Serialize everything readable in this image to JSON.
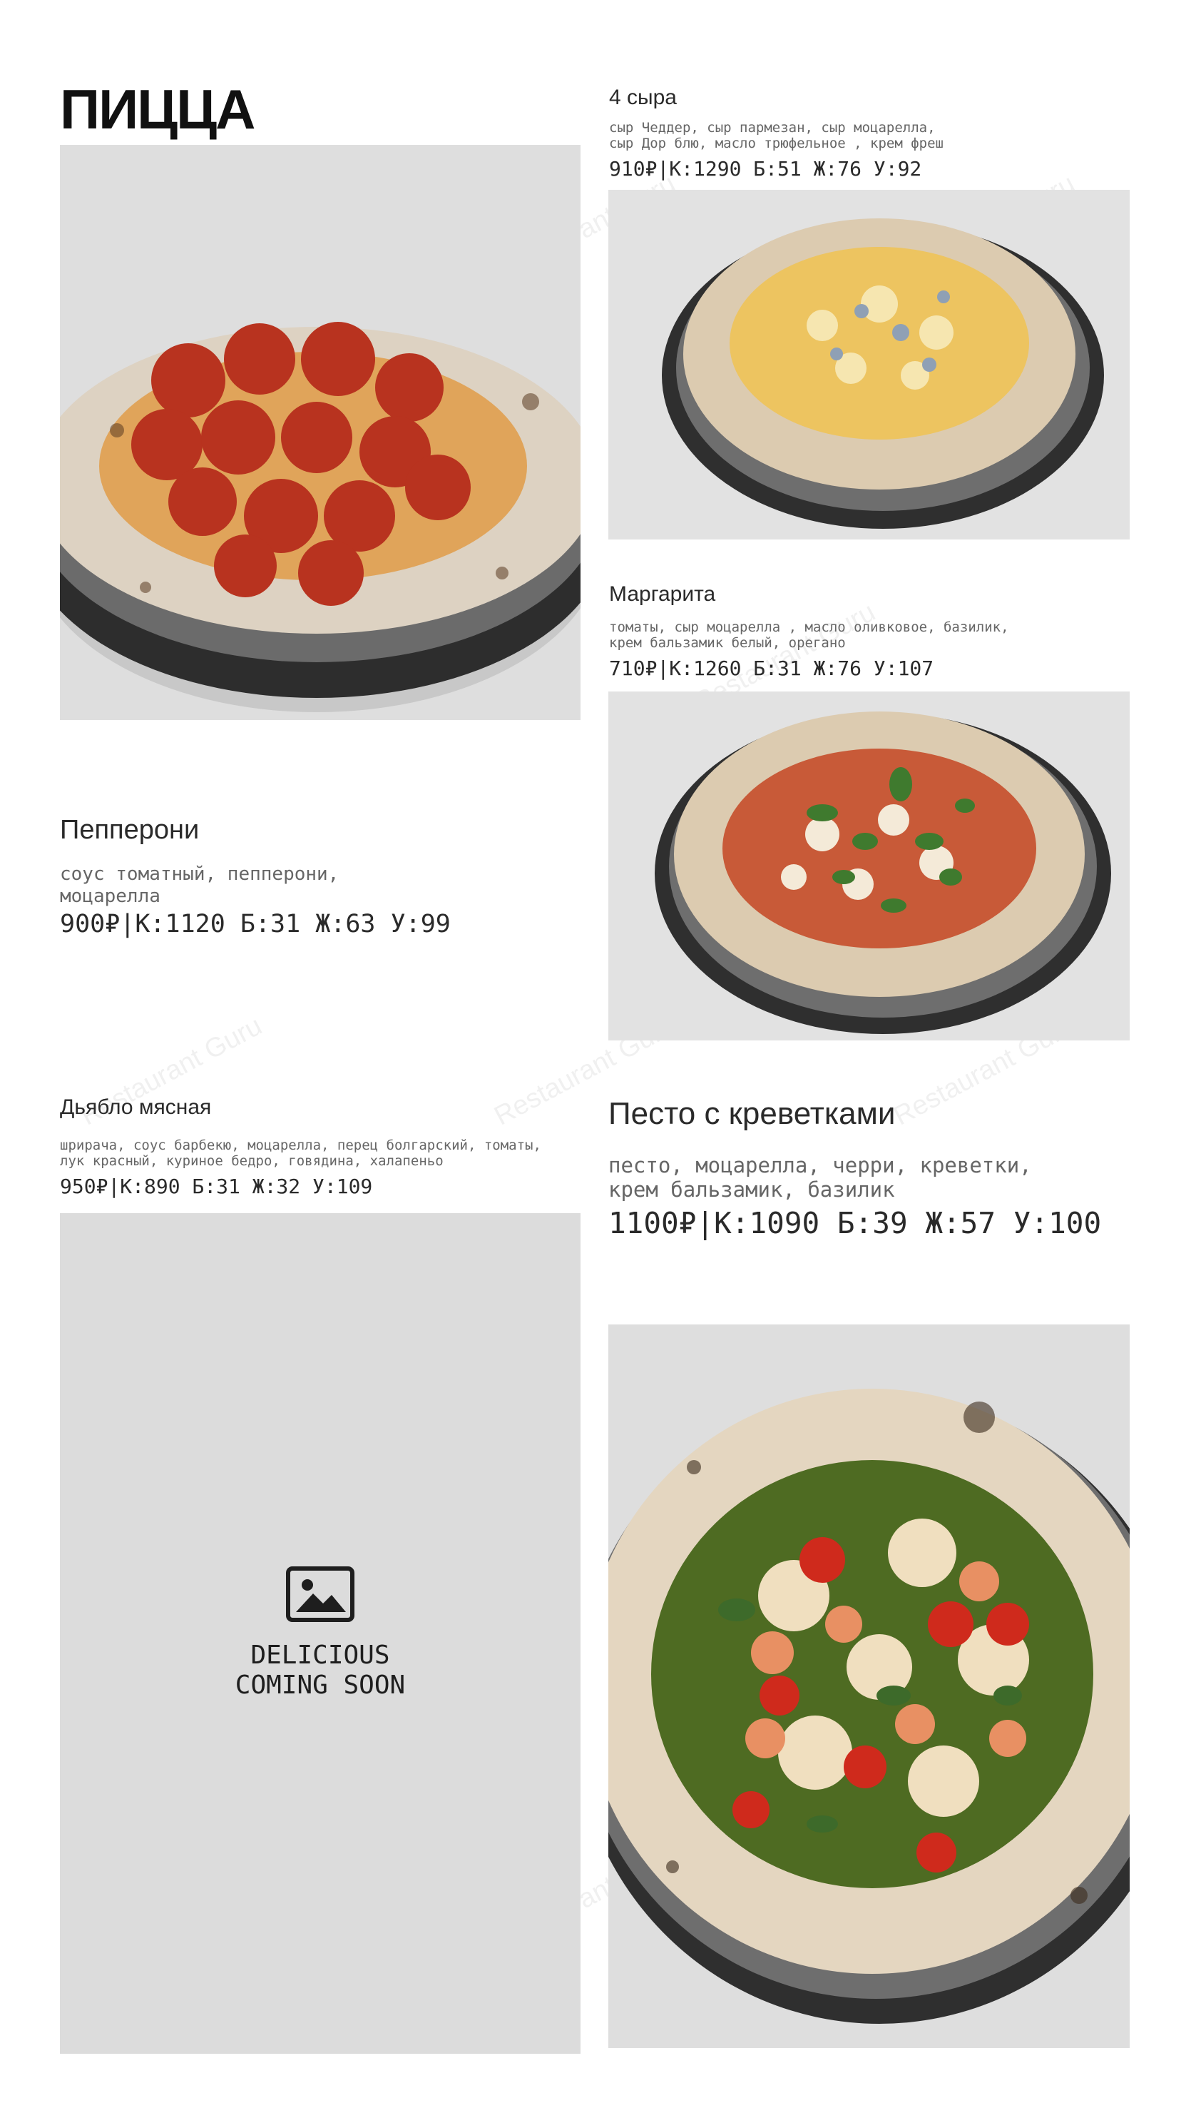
{
  "page_title": "ПИЦЦА",
  "watermark": "Restaurant Guru",
  "items": [
    {
      "name": "Пепперони",
      "description": "соус томатный, пепперони,\nмоцарелла",
      "price": "900₽|К:1120 Б:31 Ж:63 У:99"
    },
    {
      "name": "4 сыра",
      "description": "сыр Чеддер, сыр пармезан, сыр моцарелла,\nсыр Дор блю, масло трюфельное , крем фреш",
      "price": "910₽|К:1290 Б:51 Ж:76 У:92"
    },
    {
      "name": "Маргарита",
      "description": "томаты, сыр моцарелла , масло оливковое, базилик,\nкрем бальзамик белый, орегано",
      "price": "710₽|К:1260 Б:31 Ж:76 У:107"
    },
    {
      "name": "Дьябло мясная",
      "description": "шрирача, соус барбекю, моцарелла, перец болгарский, томаты,\nлук красный, куриное бедро, говядина, халапеньо",
      "price": "950₽|К:890 Б:31 Ж:32 У:109"
    },
    {
      "name": "Песто с креветками",
      "description": "песто, моцарелла, черри, креветки,\nкрем бальзамик, базилик",
      "price": "1100₽|К:1090 Б:39 Ж:57 У:100"
    }
  ],
  "placeholder": {
    "text": "DELICIOUS\nCOMING SOON",
    "icon": "image-icon"
  },
  "colors": {
    "placeholder_bg": "#dcdcdc",
    "photo_bg": "#e4e4e4"
  }
}
